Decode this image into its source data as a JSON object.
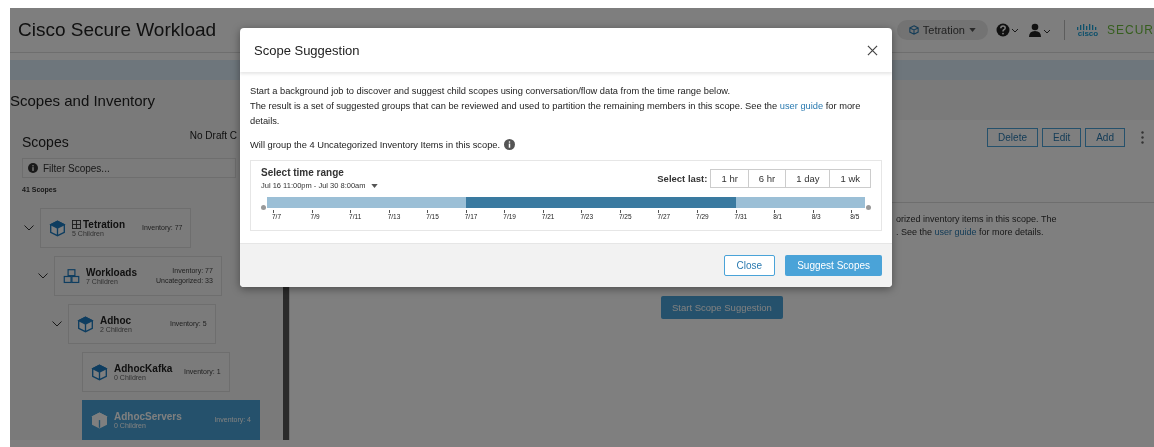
{
  "app": {
    "title": "Cisco Secure Workload",
    "scope_picker": "Tetration",
    "logo_word": "cisco",
    "brand": "SECUR"
  },
  "page": {
    "title": "Scopes and Inventory"
  },
  "scopes_panel": {
    "title": "Scopes",
    "draft_status": "No Draft C",
    "filter": {
      "placeholder": "Filter Scopes..."
    },
    "count": "41 Scopes",
    "tree": [
      {
        "name": "Tetration",
        "tenant": true,
        "kind": "scope",
        "children_label": "5 Children",
        "stats": [
          "Inventory: 77"
        ],
        "expanded": true,
        "selected": false,
        "children": [
          {
            "name": "Workloads",
            "tenant": false,
            "kind": "group",
            "children_label": "7 Children",
            "stats": [
              "Inventory: 77",
              "Uncategorized: 33"
            ],
            "expanded": true,
            "selected": false,
            "children": [
              {
                "name": "Adhoc",
                "tenant": false,
                "kind": "scope",
                "children_label": "2 Children",
                "stats": [
                  "Inventory: 5"
                ],
                "expanded": true,
                "selected": false,
                "children": [
                  {
                    "name": "AdhocKafka",
                    "tenant": false,
                    "kind": "scope",
                    "children_label": "0 Children",
                    "stats": [
                      "Inventory: 1"
                    ],
                    "expanded": false,
                    "selected": false
                  },
                  {
                    "name": "AdhocServers",
                    "tenant": false,
                    "kind": "scope",
                    "children_label": "0 Children",
                    "stats": [
                      "Inventory: 4"
                    ],
                    "expanded": false,
                    "selected": true
                  }
                ]
              }
            ]
          }
        ]
      }
    ]
  },
  "scope_detail": {
    "buttons": [
      "Delete",
      "Edit",
      "Add"
    ],
    "text_line_1": "orized inventory items in this scope. The",
    "text_line_2": ". See the",
    "link": "user guide",
    "text_line_2_end": " for more details.",
    "start_button": "Start Scope Suggestion"
  },
  "dialog": {
    "title": "Scope Suggestion",
    "intro": [
      "Start a background job to discover and suggest child scopes using conversation/flow data from the time range below.",
      "The result is a set of suggested groups that can be reviewed and used to partition the remaining members in this scope. See the"
    ],
    "link": "user guide",
    "intro_end": " for more details.",
    "group_note": "Will group the 4 Uncategorized Inventory Items in this scope.",
    "time_range": {
      "title": "Select time range",
      "range": "Jul 16 11:00pm - Jul 30 8:00am",
      "select_last_label": "Select last:",
      "presets": [
        {
          "label": "1 hr",
          "selected": false
        },
        {
          "label": "6 hr",
          "selected": false
        },
        {
          "label": "1 day",
          "selected": false
        },
        {
          "label": "1 wk",
          "selected": false
        }
      ],
      "ticks": [
        {
          "label": "7/7",
          "selected": false
        },
        {
          "label": "7/9",
          "selected": false
        },
        {
          "label": "7/11",
          "selected": false
        },
        {
          "label": "7/13",
          "selected": false
        },
        {
          "label": "7/15",
          "selected": false
        },
        {
          "label": "7/17",
          "selected": true
        },
        {
          "label": "7/19",
          "selected": true
        },
        {
          "label": "7/21",
          "selected": true
        },
        {
          "label": "7/23",
          "selected": true
        },
        {
          "label": "7/25",
          "selected": true
        },
        {
          "label": "7/27",
          "selected": true
        },
        {
          "label": "7/29",
          "selected": true
        },
        {
          "label": "7/31",
          "selected": false
        },
        {
          "label": "8/1",
          "selected": false
        },
        {
          "label": "8/3",
          "selected": false
        },
        {
          "label": "8/5",
          "selected": false
        }
      ]
    },
    "close_button": "Close",
    "suggest_button": "Suggest Scopes"
  }
}
